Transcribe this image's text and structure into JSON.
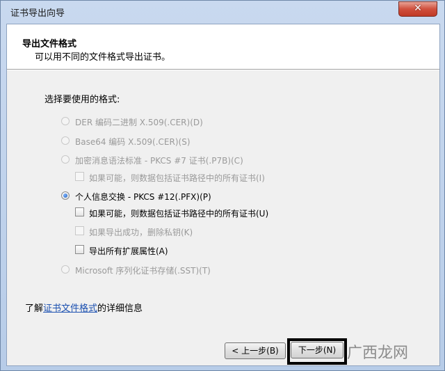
{
  "window": {
    "title": "证书导出向导",
    "close_glyph": "✕"
  },
  "header": {
    "title": "导出文件格式",
    "subtitle": "可以用不同的文件格式导出证书。"
  },
  "format_label": "选择要使用的格式:",
  "options": [
    {
      "label": "DER 编码二进制 X.509(.CER)(D)",
      "enabled": false,
      "selected": false
    },
    {
      "label": "Base64 编码 X.509(.CER)(S)",
      "enabled": false,
      "selected": false
    },
    {
      "label": "加密消息语法标准 - PKCS #7 证书(.P7B)(C)",
      "enabled": false,
      "selected": false
    },
    {
      "label": "如果可能，则数据包括证书路径中的所有证书(I)",
      "enabled": false,
      "checked": false
    },
    {
      "label": "个人信息交换 - PKCS #12(.PFX)(P)",
      "enabled": true,
      "selected": true
    },
    {
      "label": "如果可能，则数据包括证书路径中的所有证书(U)",
      "enabled": true,
      "checked": false
    },
    {
      "label": "如果导出成功，删除私钥(K)",
      "enabled": false,
      "checked": false
    },
    {
      "label": "导出所有扩展属性(A)",
      "enabled": true,
      "checked": false
    },
    {
      "label": "Microsoft 序列化证书存储(.SST)(T)",
      "enabled": false,
      "selected": false
    }
  ],
  "info": {
    "prefix": "了解",
    "link": "证书文件格式",
    "suffix": "的详细信息"
  },
  "buttons": {
    "back": "< 上一步(B)",
    "next": "下一步(N)"
  },
  "watermark": "广西龙网",
  "colors": {
    "link": "#1a4fb0",
    "radio_selected": "#1f5fb5",
    "highlight_frame": "#000000"
  }
}
